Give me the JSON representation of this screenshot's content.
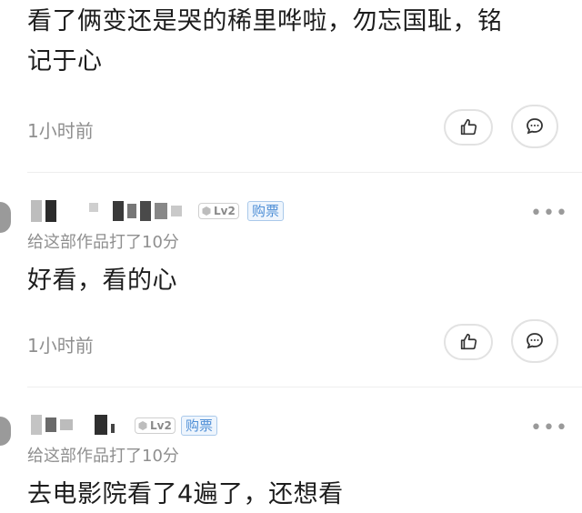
{
  "comments": [
    {
      "text_line1": "看了俩变还是哭的稀里哗啦，勿忘国耻，铭",
      "text_line2": "记于心",
      "time": "1小时前"
    },
    {
      "level": "Lv2",
      "badge": "购票",
      "rating": "给这部作品打了10分",
      "text": "好看，看的心",
      "time": "1小时前"
    },
    {
      "level": "Lv2",
      "badge": "购票",
      "rating": "给这部作品打了10分",
      "text": "去电影院看了4遍了，还想看"
    }
  ],
  "icons": {
    "like": "thumbs-up-icon",
    "reply": "comment-bubble-icon",
    "more": "more-dots-icon",
    "level": "level-cube-icon"
  },
  "colors": {
    "badge_blue": "#4f8fd6",
    "muted_gray": "#8f8f8f",
    "divider": "#eeeeee"
  }
}
